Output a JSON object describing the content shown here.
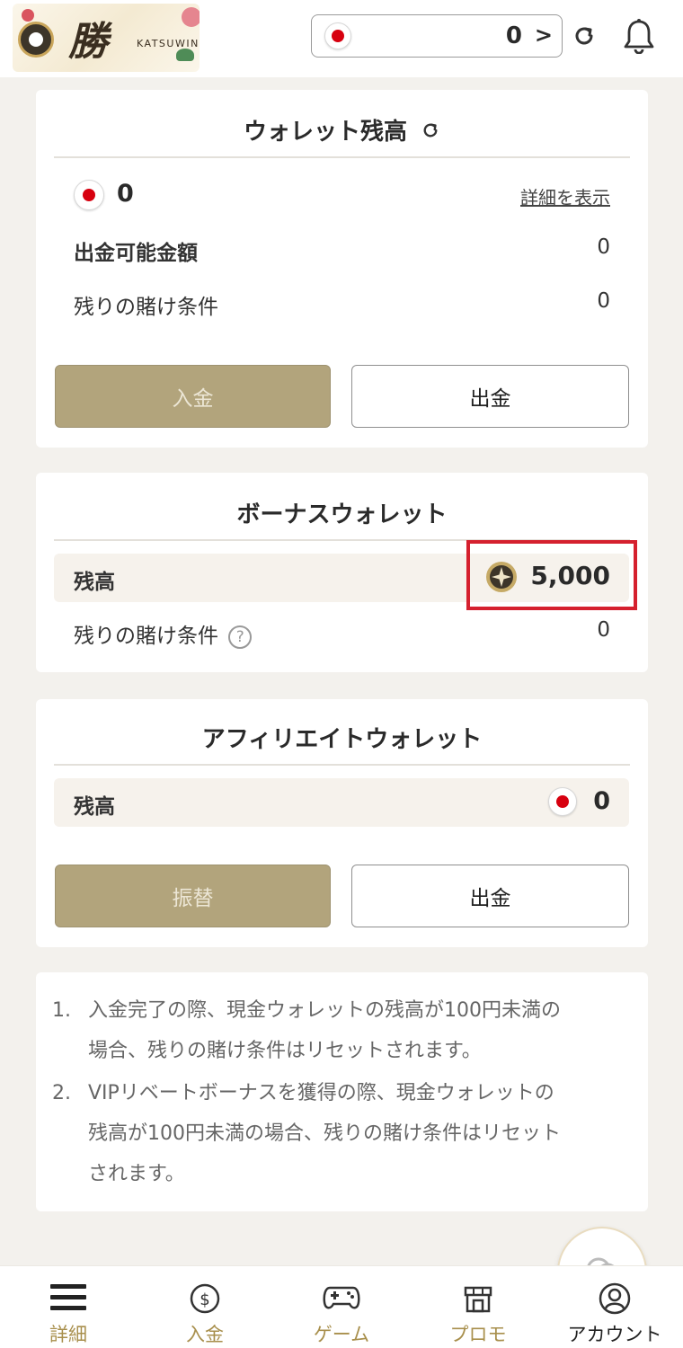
{
  "header": {
    "brand": "KATSUWIN",
    "brand_kanji": "勝",
    "balance": "0",
    "chevron": ">"
  },
  "wallet": {
    "title": "ウォレット残高",
    "balance": "0",
    "details_link": "詳細を表示",
    "withdrawable_label": "出金可能金額",
    "withdrawable_value": "0",
    "wager_label": "残りの賭け条件",
    "wager_value": "0",
    "deposit_button": "入金",
    "withdraw_button": "出金"
  },
  "bonus": {
    "title": "ボーナスウォレット",
    "balance_label": "残高",
    "balance_value": "5,000",
    "wager_label": "残りの賭け条件",
    "wager_value": "0"
  },
  "affiliate": {
    "title": "アフィリエイトウォレット",
    "balance_label": "残高",
    "balance_value": "0",
    "transfer_button": "振替",
    "withdraw_button": "出金"
  },
  "notes": [
    {
      "num": "1.",
      "line1": "入金完了の際、現金ウォレットの残高が100円未満の",
      "line2": "場合、残りの賭け条件はリセットされます。"
    },
    {
      "num": "2.",
      "line1": "VIPリベートボーナスを獲得の際、現金ウォレットの",
      "line2": "残高が100円未満の場合、残りの賭け条件はリセット",
      "line3": "されます。"
    }
  ],
  "nav": {
    "details": "詳細",
    "deposit": "入金",
    "games": "ゲーム",
    "promo": "プロモ",
    "account": "アカウント"
  },
  "colors": {
    "gold_accent": "#b2a47c",
    "active_nav": "#a88f4c",
    "flag_red": "#d7000f",
    "highlight_red": "#d5202e"
  }
}
